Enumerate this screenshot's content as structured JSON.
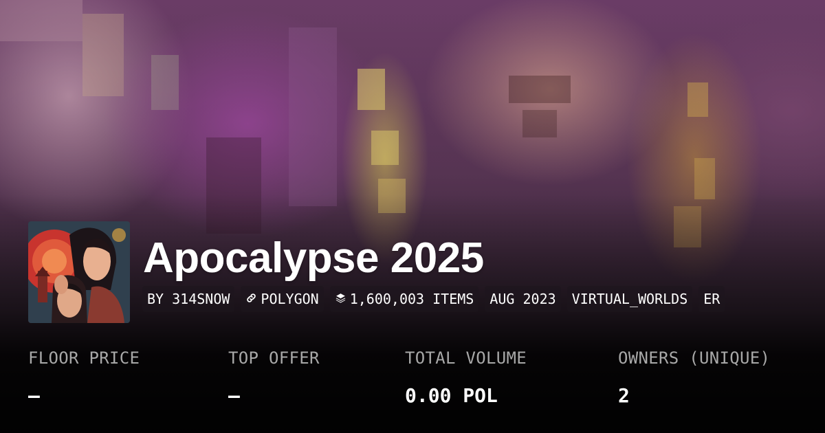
{
  "collection": {
    "title": "Apocalypse 2025"
  },
  "tags": [
    {
      "label": "BY 314SNOW",
      "icon": ""
    },
    {
      "label": "POLYGON",
      "icon": "link-icon"
    },
    {
      "label": "1,600,003 ITEMS",
      "icon": "layers-icon"
    },
    {
      "label": "AUG 2023",
      "icon": ""
    },
    {
      "label": "VIRTUAL_WORLDS",
      "icon": ""
    },
    {
      "label": "ER",
      "icon": ""
    }
  ],
  "stats": [
    {
      "label": "FLOOR PRICE",
      "value": "–"
    },
    {
      "label": "TOP OFFER",
      "value": "–"
    },
    {
      "label": "TOTAL VOLUME",
      "value": "0.00 POL"
    },
    {
      "label": "OWNERS (UNIQUE)",
      "value": "2"
    }
  ],
  "colors": {
    "background": "#0a0a0a",
    "label": "#a8a8a8",
    "text": "#ffffff"
  }
}
